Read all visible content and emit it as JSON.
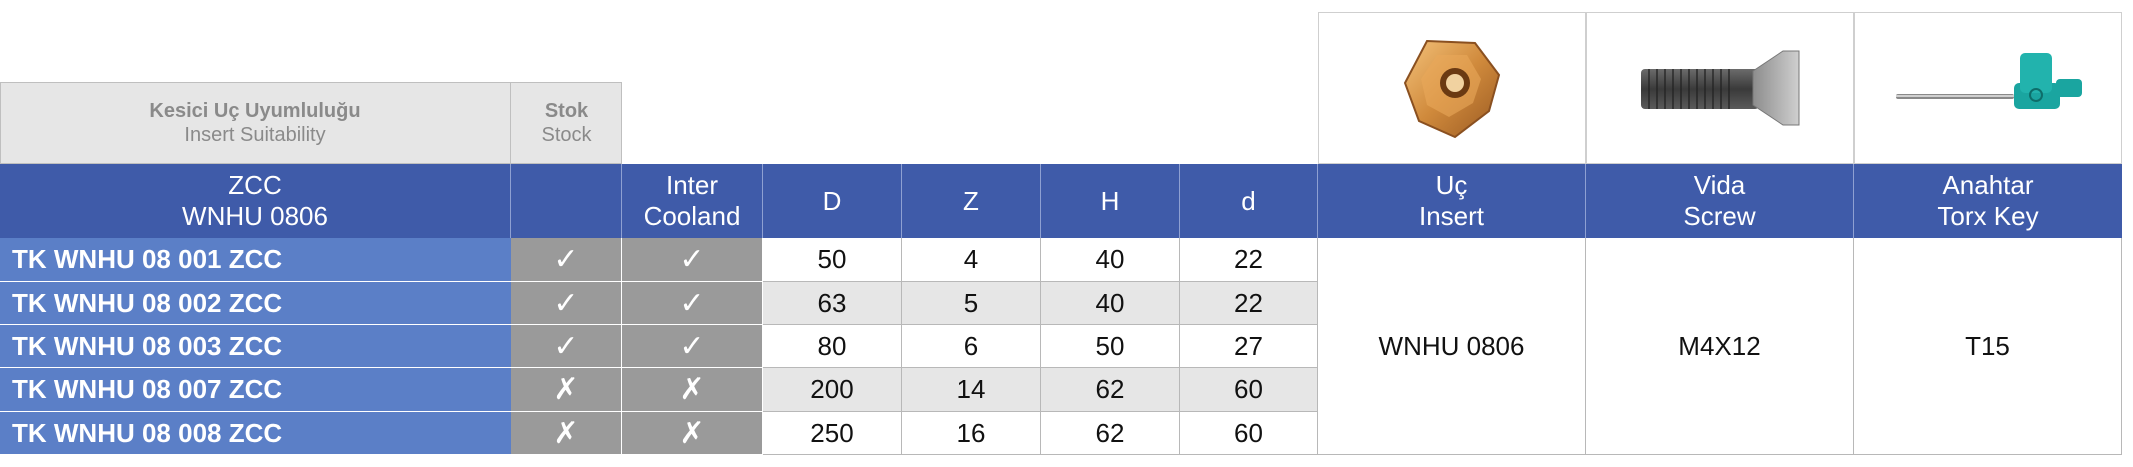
{
  "suitability": {
    "title_tr": "Kesici Uç Uyumluluğu",
    "title_en": "Insert Suitability",
    "stock_tr": "Stok",
    "stock_en": "Stock"
  },
  "header": {
    "zcc_l1": "ZCC",
    "zcc_l2": "WNHU 0806",
    "inter_l1": "Inter",
    "inter_l2": "Cooland",
    "D": "D",
    "Z": "Z",
    "H": "H",
    "d": "d",
    "insert_l1": "Uç",
    "insert_l2": "Insert",
    "screw_l1": "Vida",
    "screw_l2": "Screw",
    "key_l1": "Anahtar",
    "key_l2": "Torx Key"
  },
  "icons": {
    "insert": "insert-image-icon",
    "screw": "screw-image-icon",
    "key": "torx-key-image-icon"
  },
  "colors": {
    "header_blue": "#3f5ba9",
    "code_blue": "#5b7fc7",
    "tick_gray": "#9a9a9a",
    "alt_row": "#e6e6e6"
  },
  "rows": [
    {
      "code": "TK WNHU 08 001 ZCC",
      "stock": "✓",
      "inter": "✓",
      "D": "50",
      "Z": "4",
      "H": "40",
      "d": "22"
    },
    {
      "code": "TK WNHU 08 002 ZCC",
      "stock": "✓",
      "inter": "✓",
      "D": "63",
      "Z": "5",
      "H": "40",
      "d": "22"
    },
    {
      "code": "TK WNHU 08 003 ZCC",
      "stock": "✓",
      "inter": "✓",
      "D": "80",
      "Z": "6",
      "H": "50",
      "d": "27"
    },
    {
      "code": "TK WNHU 08 007 ZCC",
      "stock": "✗",
      "inter": "✗",
      "D": "200",
      "Z": "14",
      "H": "62",
      "d": "60"
    },
    {
      "code": "TK WNHU 08 008 ZCC",
      "stock": "✗",
      "inter": "✗",
      "D": "250",
      "Z": "16",
      "H": "62",
      "d": "60"
    }
  ],
  "parts": {
    "insert": "WNHU 0806",
    "screw": "M4X12",
    "key": "T15"
  }
}
